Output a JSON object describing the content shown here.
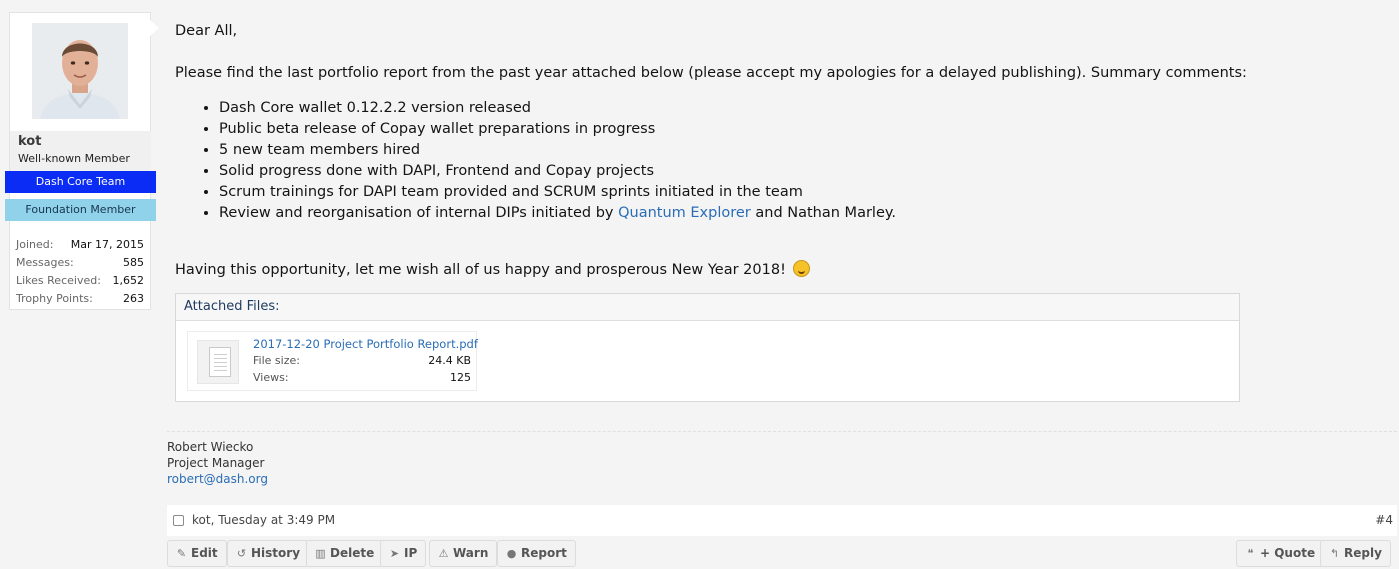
{
  "user": {
    "name": "kot",
    "title": "Well-known Member",
    "banners": [
      "Dash Core Team",
      "Foundation Member"
    ],
    "stats": [
      {
        "label": "Joined:",
        "value": "Mar 17, 2015"
      },
      {
        "label": "Messages:",
        "value": "585"
      },
      {
        "label": "Likes Received:",
        "value": "1,652"
      },
      {
        "label": "Trophy Points:",
        "value": "263"
      }
    ]
  },
  "message": {
    "greeting": "Dear All,",
    "intro": "Please find the last portfolio report from the past year attached below (please accept my apologies for a delayed publishing). Summary comments:",
    "bullets": [
      "Dash Core wallet 0.12.2.2 version released",
      "Public beta release of Copay wallet preparations in progress",
      "5 new team members hired",
      "Solid progress done with DAPI, Frontend and Copay projects",
      "Scrum trainings for DAPI team provided and SCRUM sprints initiated in the team"
    ],
    "last_bullet": {
      "before": "Review and reorganisation of internal DIPs initiated by ",
      "link": "Quantum Explorer",
      "after": " and Nathan Marley."
    },
    "closing": "Having this opportunity, let me wish all of us happy and prosperous New Year 2018!",
    "smiley_icon": "smile-icon"
  },
  "attachments": {
    "heading": "Attached Files:",
    "file": {
      "name": "2017-12-20 Project Portfolio Report.pdf",
      "size_label": "File size:",
      "size": "24.4 KB",
      "views_label": "Views:",
      "views": "125"
    }
  },
  "signature": {
    "name": "Robert Wiecko",
    "role": "Project Manager",
    "email": "robert@dash.org"
  },
  "post": {
    "info": "kot, Tuesday at 3:49 PM",
    "number": "#4"
  },
  "actions": {
    "edit": "Edit",
    "history": "History",
    "delete": "Delete",
    "ip": "IP",
    "warn": "Warn",
    "report": "Report",
    "quote": "+ Quote",
    "reply": "Reply"
  },
  "colors": {
    "team_banner": "#0a2cf5",
    "foundation_banner": "#8fd2ea",
    "link": "#2a6db5"
  }
}
